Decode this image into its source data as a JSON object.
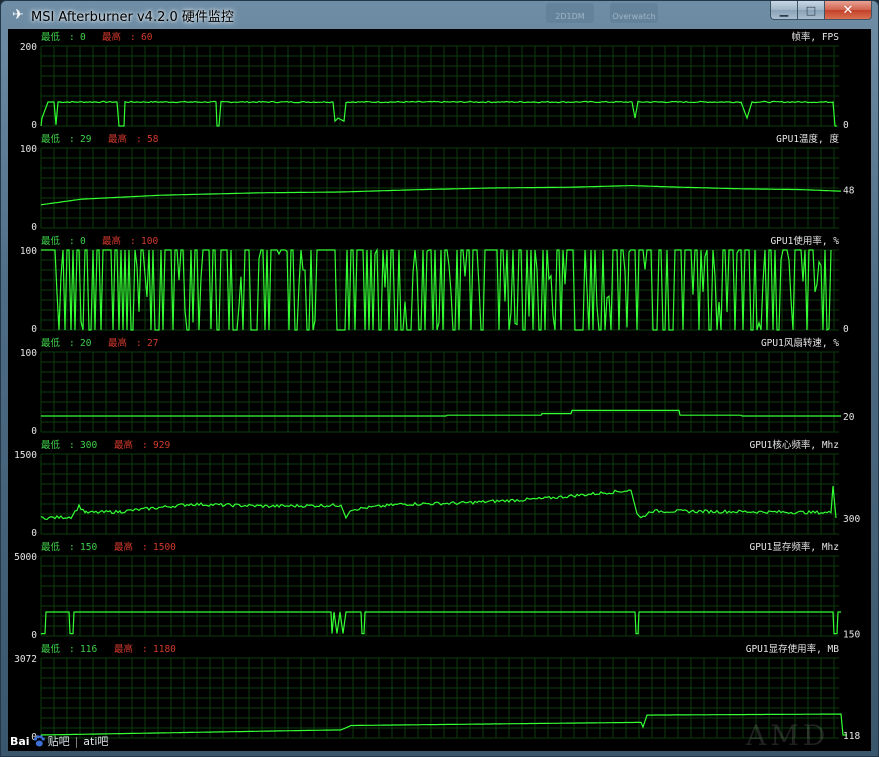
{
  "window": {
    "title": "MSI Afterburner v4.2.0 硬件监控",
    "icons": {
      "app": "msi-dragon-icon",
      "minimize": "minimize-icon",
      "maximize": "maximize-icon",
      "close": "close-icon"
    }
  },
  "background_taskbar": {
    "tiles": [
      "2D1DM",
      "Overwatch"
    ]
  },
  "graphs": [
    {
      "id": "fps",
      "label": "帧率, FPS",
      "min_label": "最低",
      "min_value": "0",
      "max_label": "最高",
      "max_value": "60",
      "scale_top": "200",
      "scale_bottom": "0",
      "current": "0",
      "range": [
        0,
        200
      ],
      "segments": [
        [
          0,
          0
        ],
        [
          1,
          20
        ],
        [
          7,
          60
        ],
        [
          13,
          60
        ],
        [
          15,
          3
        ],
        [
          17,
          60
        ],
        [
          76,
          60
        ],
        [
          78,
          0
        ],
        [
          83,
          0
        ],
        [
          84,
          60
        ],
        [
          175,
          60
        ],
        [
          176,
          0
        ],
        [
          178,
          0
        ],
        [
          180,
          60
        ],
        [
          261,
          60
        ],
        [
          292,
          60
        ],
        [
          294,
          12
        ],
        [
          297,
          20
        ],
        [
          300,
          16
        ],
        [
          303,
          12
        ],
        [
          305,
          60
        ],
        [
          591,
          60
        ],
        [
          594,
          20
        ],
        [
          597,
          60
        ],
        [
          700,
          60
        ],
        [
          706,
          20
        ],
        [
          711,
          60
        ],
        [
          792,
          60
        ],
        [
          794,
          0
        ],
        [
          796,
          0
        ]
      ]
    },
    {
      "id": "temp",
      "label": "GPU1温度, 度",
      "min_label": "最低",
      "min_value": "29",
      "max_label": "最高",
      "max_value": "58",
      "scale_top": "100",
      "scale_bottom": "0",
      "current": "48",
      "range": [
        0,
        100
      ],
      "segments": [
        [
          0,
          29
        ],
        [
          40,
          36
        ],
        [
          120,
          41
        ],
        [
          220,
          44
        ],
        [
          300,
          45
        ],
        [
          380,
          48
        ],
        [
          450,
          50
        ],
        [
          530,
          51
        ],
        [
          590,
          53
        ],
        [
          640,
          51
        ],
        [
          700,
          49
        ],
        [
          760,
          48
        ],
        [
          800,
          46
        ]
      ]
    },
    {
      "id": "usage",
      "label": "GPU1使用率, %",
      "min_label": "最低",
      "min_value": "0",
      "max_label": "最高",
      "max_value": "100",
      "scale_top": "100",
      "scale_bottom": "0",
      "current": "0",
      "range": [
        0,
        100
      ],
      "noisy": true,
      "gap": [
        295,
        305
      ]
    },
    {
      "id": "fan",
      "label": "GPU1风扇转速, %",
      "min_label": "最低",
      "min_value": "20",
      "max_label": "最高",
      "max_value": "27",
      "scale_top": "100",
      "scale_bottom": "0",
      "current": "20",
      "range": [
        0,
        100
      ],
      "segments": [
        [
          0,
          20
        ],
        [
          405,
          20
        ],
        [
          406,
          21
        ],
        [
          500,
          21
        ],
        [
          501,
          23
        ],
        [
          530,
          23
        ],
        [
          531,
          27
        ],
        [
          638,
          27
        ],
        [
          639,
          21
        ],
        [
          700,
          21
        ],
        [
          701,
          20
        ],
        [
          800,
          20
        ]
      ]
    },
    {
      "id": "core",
      "label": "GPU1核心频率, Mhz",
      "min_label": "最低",
      "min_value": "300",
      "max_label": "最高",
      "max_value": "929",
      "scale_top": "1500",
      "scale_bottom": "0",
      "current": "300",
      "range": [
        0,
        1500
      ],
      "segments": [
        [
          0,
          300
        ],
        [
          30,
          320
        ],
        [
          38,
          520
        ],
        [
          45,
          400
        ],
        [
          80,
          420
        ],
        [
          150,
          560
        ],
        [
          230,
          520
        ],
        [
          300,
          540
        ],
        [
          305,
          300
        ],
        [
          310,
          460
        ],
        [
          360,
          560
        ],
        [
          420,
          580
        ],
        [
          500,
          660
        ],
        [
          590,
          820
        ],
        [
          596,
          380
        ],
        [
          600,
          300
        ],
        [
          610,
          430
        ],
        [
          700,
          420
        ],
        [
          790,
          400
        ],
        [
          792,
          900
        ],
        [
          795,
          300
        ]
      ]
    },
    {
      "id": "memclk",
      "label": "GPU1显存频率, Mhz",
      "min_label": "最低",
      "min_value": "150",
      "max_label": "最高",
      "max_value": "1500",
      "scale_top": "5000",
      "scale_bottom": "0",
      "current": "150",
      "range": [
        0,
        5000
      ],
      "segments": [
        [
          0,
          150
        ],
        [
          4,
          150
        ],
        [
          5,
          1500
        ],
        [
          28,
          1500
        ],
        [
          29,
          150
        ],
        [
          32,
          150
        ],
        [
          33,
          1500
        ],
        [
          290,
          1500
        ],
        [
          291,
          150
        ],
        [
          293,
          1500
        ],
        [
          296,
          150
        ],
        [
          299,
          1500
        ],
        [
          302,
          150
        ],
        [
          305,
          1500
        ],
        [
          320,
          1500
        ],
        [
          321,
          150
        ],
        [
          323,
          150
        ],
        [
          324,
          1500
        ],
        [
          594,
          1500
        ],
        [
          595,
          150
        ],
        [
          597,
          150
        ],
        [
          598,
          1500
        ],
        [
          792,
          1500
        ],
        [
          793,
          150
        ],
        [
          796,
          150
        ],
        [
          797,
          1500
        ],
        [
          800,
          1500
        ]
      ]
    },
    {
      "id": "memuse",
      "label": "GPU1显存使用率, MB",
      "min_label": "最低",
      "min_value": "116",
      "max_label": "最高",
      "max_value": "1180",
      "scale_top": "3072",
      "scale_bottom": "0",
      "current": "118",
      "range": [
        0,
        3072
      ],
      "segments": [
        [
          0,
          116
        ],
        [
          280,
          300
        ],
        [
          300,
          310
        ],
        [
          310,
          480
        ],
        [
          500,
          560
        ],
        [
          600,
          600
        ],
        [
          602,
          420
        ],
        [
          606,
          880
        ],
        [
          800,
          920
        ],
        [
          802,
          116
        ],
        [
          806,
          118
        ]
      ]
    }
  ],
  "watermark": {
    "brand": "Bai",
    "brand_icon": "paw-icon",
    "forum": "贴吧",
    "separator": "|",
    "sub": "ati吧",
    "amd": "AMD"
  },
  "colors": {
    "line": "#33ff33",
    "grid": "#0c3a0c",
    "min_text": "#3fd24a",
    "max_text": "#d43a2c",
    "label_text": "#e6e6e6",
    "scale_text": "#e6e6e6"
  }
}
